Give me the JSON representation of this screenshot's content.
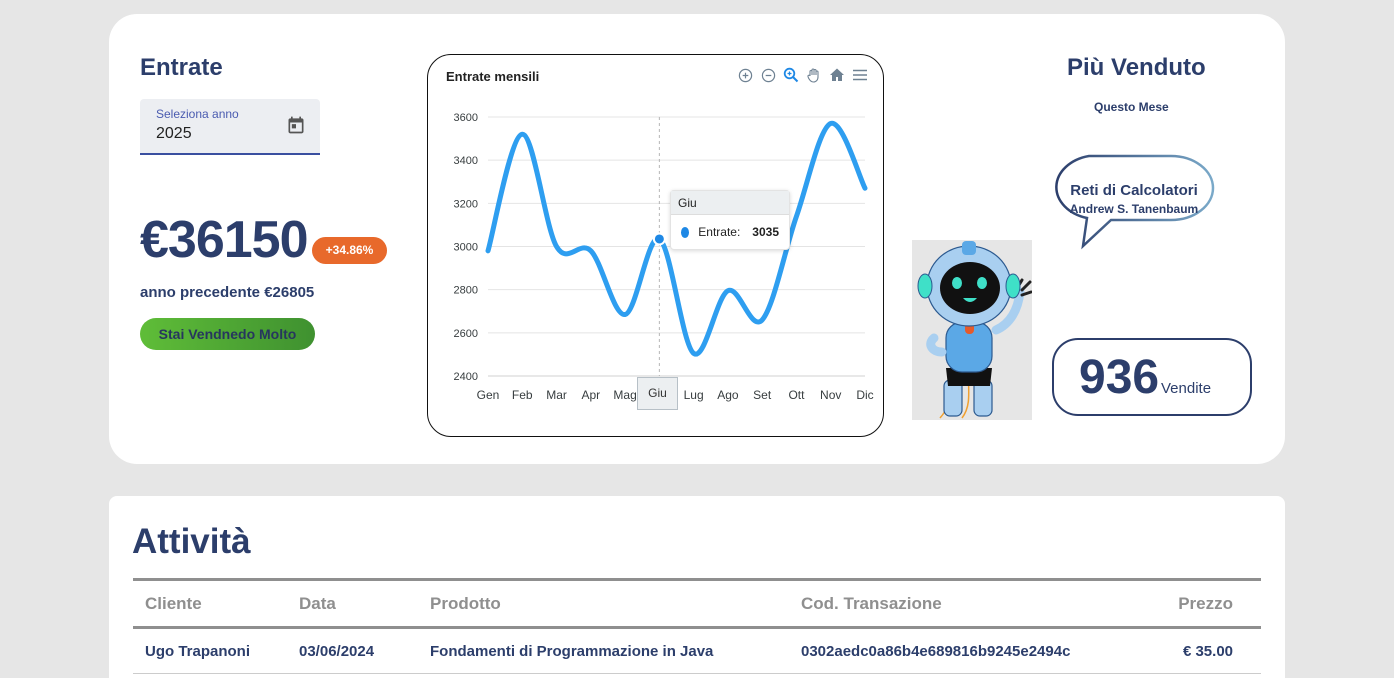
{
  "income": {
    "title": "Entrate",
    "year_label": "Seleziona anno",
    "year_value": "2025",
    "amount": "€36150",
    "change_badge": "+34.86%",
    "previous_year": "anno precedente €26805",
    "status_label": "Stai Vendnedo Molto"
  },
  "chart": {
    "title": "Entrate mensili",
    "tools": [
      "zoom-in-icon",
      "zoom-out-icon",
      "zoom-select-icon",
      "pan-hand-icon",
      "home-icon",
      "menu-icon"
    ],
    "tooltip": {
      "header": "Giu",
      "series_label": "Entrate:",
      "value": "3035"
    },
    "crosshair_label": "Giu",
    "line_color": "#2e9ef0"
  },
  "chart_data": {
    "type": "line",
    "title": "Entrate mensili",
    "categories": [
      "Gen",
      "Feb",
      "Mar",
      "Apr",
      "Mag",
      "Giu",
      "Lug",
      "Ago",
      "Set",
      "Ott",
      "Nov",
      "Dic"
    ],
    "series": [
      {
        "name": "Entrate",
        "values": [
          2980,
          3520,
          3000,
          2980,
          2685,
          3035,
          2505,
          2795,
          2660,
          3140,
          3570,
          3270
        ]
      }
    ],
    "y_ticks": [
      2400,
      2600,
      2800,
      3000,
      3200,
      3400,
      3600
    ],
    "ylim": [
      2400,
      3600
    ],
    "grid": true,
    "xlabel": "",
    "ylabel": ""
  },
  "best_seller": {
    "title": "Più Venduto",
    "subtitle": "Questo Mese",
    "book_title": "Reti di Calcolatori",
    "book_author": "Andrew S. Tanenbaum",
    "sales_count": "936",
    "sales_label": "Vendite"
  },
  "activity": {
    "title": "Attività",
    "columns": [
      "Cliente",
      "Data",
      "Prodotto",
      "Cod. Transazione",
      "Prezzo"
    ],
    "rows": [
      [
        "Ugo Trapanoni",
        "03/06/2024",
        "Fondamenti di Programmazione in Java",
        "0302aedc0a86b4e689816b9245e2494c",
        "€ 35.00"
      ]
    ]
  }
}
